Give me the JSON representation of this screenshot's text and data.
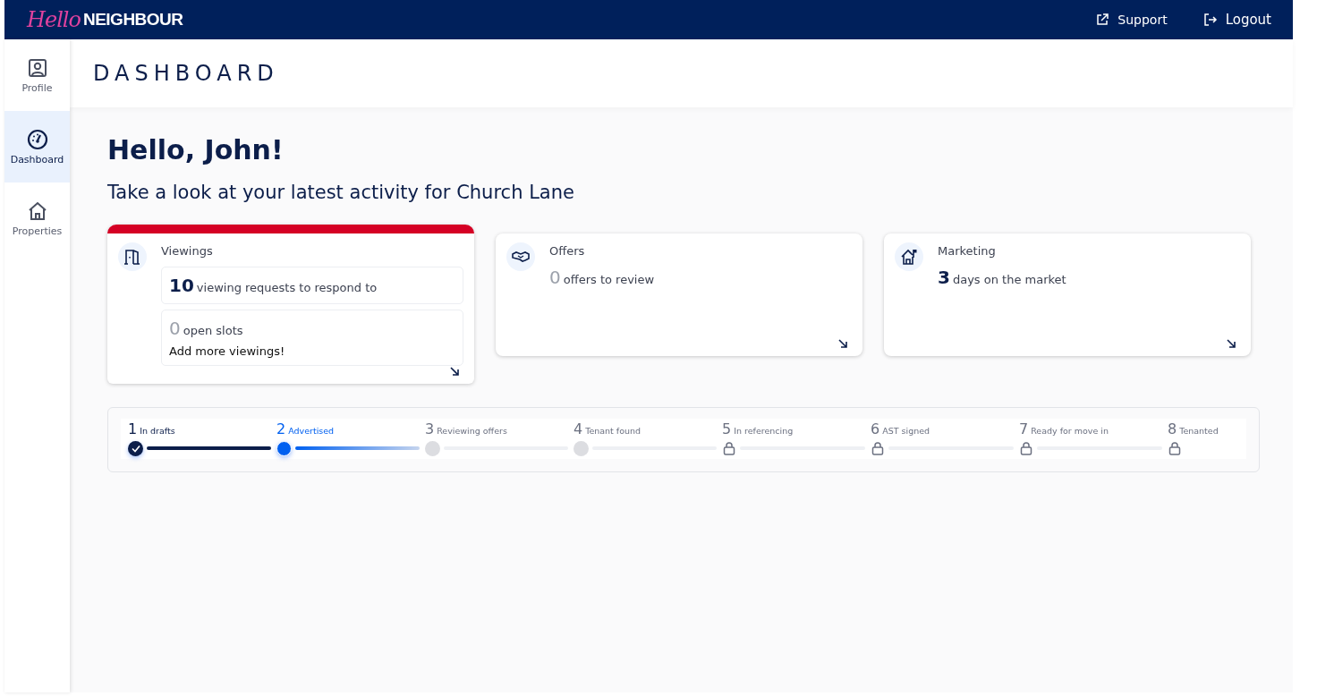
{
  "header": {
    "logo_script": "Hello",
    "logo_word": "NEIGHBOUR",
    "links": [
      "Support",
      "Logout"
    ]
  },
  "sidebar": {
    "items": [
      {
        "label": "Profile",
        "selected": false
      },
      {
        "label": "Dashboard",
        "selected": true
      },
      {
        "label": "Properties",
        "selected": false
      }
    ]
  },
  "page_title": "DASHBOARD",
  "greeting": "Hello, John!",
  "subtitle": "Take a look at your latest activity for Church Lane",
  "cards": [
    {
      "title": "Viewings",
      "alert": true,
      "stats": [
        {
          "kind": "boxed",
          "number": "10",
          "muted": false,
          "text": "viewing requests to respond to"
        },
        {
          "kind": "boxed",
          "number": "0",
          "muted": true,
          "text": "open slots",
          "note": "Add more viewings!"
        }
      ]
    },
    {
      "title": "Offers",
      "alert": false,
      "stats": [
        {
          "kind": "plain",
          "number": "0",
          "muted": true,
          "text": "offers to review"
        }
      ]
    },
    {
      "title": "Marketing",
      "alert": false,
      "stats": [
        {
          "kind": "plain",
          "number": "3",
          "muted": false,
          "text": "days on the market"
        }
      ]
    }
  ],
  "progress": {
    "steps": [
      {
        "number": "1",
        "label": "In drafts",
        "kind": "done"
      },
      {
        "number": "2",
        "label": "Advertised",
        "kind": "current"
      },
      {
        "number": "3",
        "label": "Reviewing offers",
        "kind": "pending"
      },
      {
        "number": "4",
        "label": "Tenant found",
        "kind": "pending"
      },
      {
        "number": "5",
        "label": "In referencing",
        "kind": "locked"
      },
      {
        "number": "6",
        "label": "AST signed",
        "kind": "locked"
      },
      {
        "number": "7",
        "label": "Ready for move in",
        "kind": "locked"
      },
      {
        "number": "8",
        "label": "Tenanted",
        "kind": "locked"
      }
    ]
  }
}
